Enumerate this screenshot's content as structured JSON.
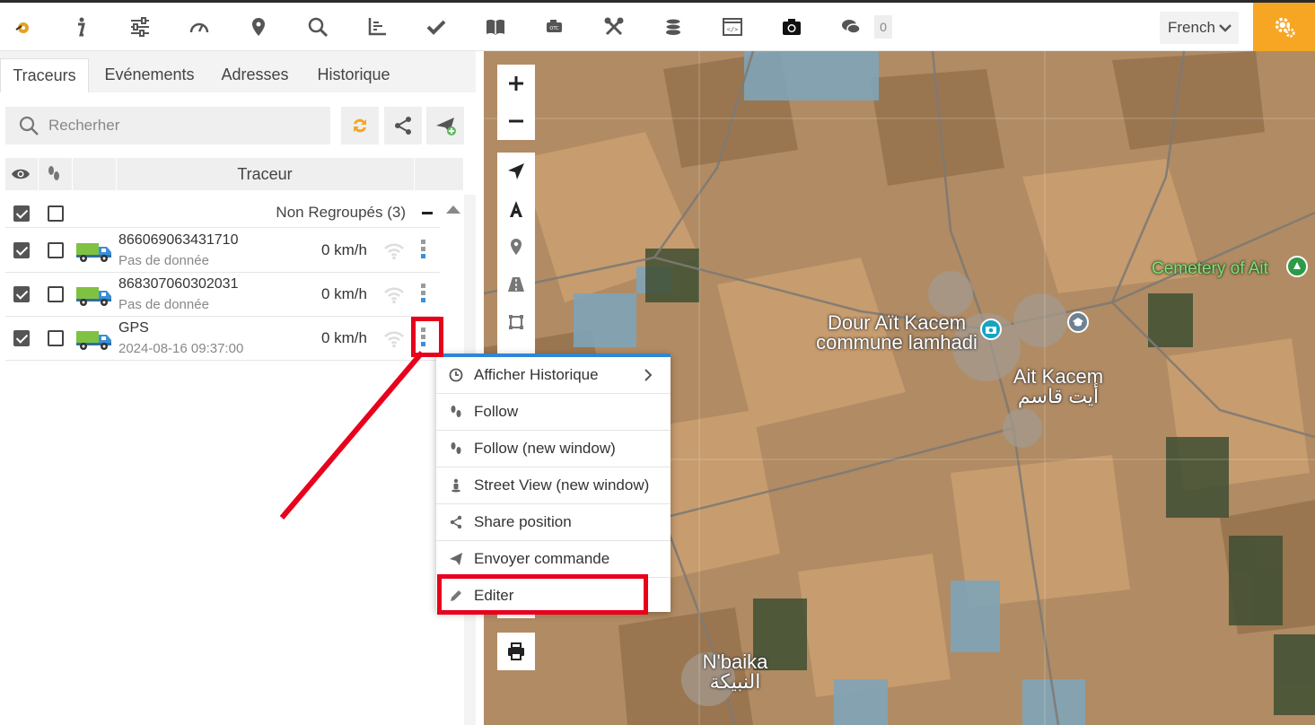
{
  "toolbar": {
    "message_count": "0",
    "language": "French",
    "icons": [
      "logo-icon",
      "info-icon",
      "filters-icon",
      "gauge-icon",
      "map-pin-icon",
      "search-icon",
      "chart-axis-icon",
      "check-icon",
      "book-icon",
      "engine-obd-icon",
      "tools-icon",
      "coins-icon",
      "code-window-icon",
      "camera-icon",
      "chat-icon",
      "settings-gear-icon"
    ]
  },
  "tabs": [
    "Traceurs",
    "Evénements",
    "Adresses",
    "Historique"
  ],
  "search": {
    "placeholder": "Recherher"
  },
  "table": {
    "header": "Traceur"
  },
  "group": {
    "label": "Non Regroupés (3)"
  },
  "devices": [
    {
      "name": "866069063431710",
      "sub": "Pas de donnée",
      "speed": "0 km/h",
      "visible": true,
      "follow": false
    },
    {
      "name": "868307060302031",
      "sub": "Pas de donnée",
      "speed": "0 km/h",
      "visible": true,
      "follow": false
    },
    {
      "name": "GPS",
      "sub": "2024-08-16 09:37:00",
      "speed": "0 km/h",
      "visible": true,
      "follow": false
    }
  ],
  "context_menu": {
    "items": [
      {
        "label": "Afficher Historique",
        "icon": "clock-icon",
        "submenu": true
      },
      {
        "label": "Follow",
        "icon": "footprints-icon"
      },
      {
        "label": "Follow (new window)",
        "icon": "footprints-icon"
      },
      {
        "label": "Street View (new window)",
        "icon": "pegman-icon"
      },
      {
        "label": "Share position",
        "icon": "share-icon"
      },
      {
        "label": "Envoyer commande",
        "icon": "send-icon"
      },
      {
        "label": "Editer",
        "icon": "pencil-icon"
      }
    ]
  },
  "map": {
    "labels": {
      "cemetery": "Cemetery of Ait",
      "dour_line1": "Dour Aït Kacem",
      "dour_line2": "commune lamhadi",
      "ait_kacem": "Ait Kacem",
      "ait_kacem_ar": "أيت قاسم",
      "nbaika": "N'baika",
      "nbaika_ar": "النبيكة"
    }
  },
  "colors": {
    "accent": "#f6a623",
    "menu_border": "#2f86d5",
    "highlight": "#e8001c"
  }
}
